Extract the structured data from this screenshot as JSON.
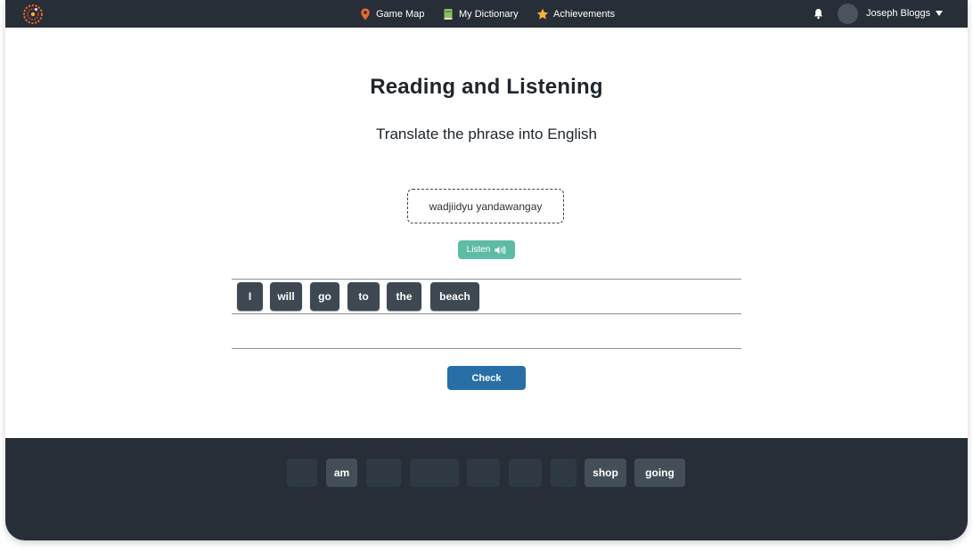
{
  "nav": {
    "links": [
      {
        "label": "Game Map",
        "icon": "map-pin-icon"
      },
      {
        "label": "My Dictionary",
        "icon": "book-icon"
      },
      {
        "label": "Achievements",
        "icon": "star-icon"
      }
    ],
    "user": {
      "name": "Joseph Bloggs"
    }
  },
  "exercise": {
    "title": "Reading and Listening",
    "instruction": "Translate the phrase into English",
    "phrase": "wadjiidyu yandawangay",
    "listen_label": "Listen",
    "answer_tiles": [
      "I",
      "will",
      "go",
      "to",
      "the",
      "beach"
    ],
    "check_label": "Check"
  },
  "word_bank": {
    "tiles": [
      {
        "label": "",
        "used": true
      },
      {
        "label": "am",
        "used": false
      },
      {
        "label": "",
        "used": true
      },
      {
        "label": "",
        "used": true
      },
      {
        "label": "",
        "used": true
      },
      {
        "label": "",
        "used": true
      },
      {
        "label": "",
        "used": true
      },
      {
        "label": "shop",
        "used": false
      },
      {
        "label": "going",
        "used": false
      }
    ]
  },
  "colors": {
    "nav_bg": "#272e37",
    "tile": "#3d4852",
    "listen": "#5dbba6",
    "check": "#276fa6",
    "map_pin": "#e8692a",
    "book": "#8cc063",
    "star": "#f5b335"
  }
}
